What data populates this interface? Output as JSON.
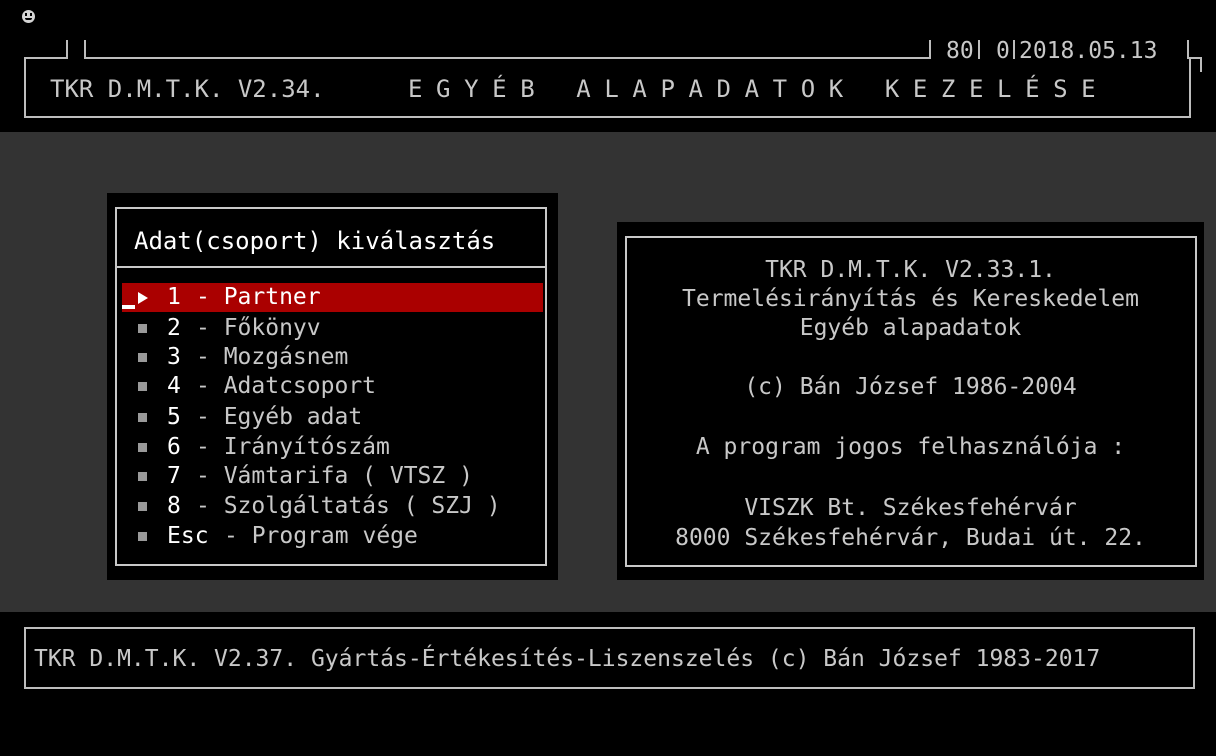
{
  "header": {
    "app_version": "TKR D.M.T.K. V2.34.",
    "screen_title": "EGYÉB ALAPADATOK KEZELÉSE",
    "stat_a": "80",
    "stat_b": "0",
    "date": "2018.05.13"
  },
  "menu": {
    "title": "Adat(csoport) kiválasztás",
    "selected_index": 0,
    "items": [
      {
        "key": "1",
        "label": "- Partner"
      },
      {
        "key": "2",
        "label": "- Főkönyv"
      },
      {
        "key": "3",
        "label": "- Mozgásnem"
      },
      {
        "key": "4",
        "label": "- Adatcsoport"
      },
      {
        "key": "5",
        "label": "- Egyéb adat"
      },
      {
        "key": "6",
        "label": "- Irányítószám"
      },
      {
        "key": "7",
        "label": "- Vámtarifa ( VTSZ )"
      },
      {
        "key": "8",
        "label": "- Szolgáltatás ( SZJ )"
      },
      {
        "key": "Esc",
        "label": "- Program vége"
      }
    ]
  },
  "info": {
    "version": "TKR D.M.T.K. V2.33.1.",
    "subtitle": "Termelésirányítás és Kereskedelem",
    "module": "Egyéb alapadatok",
    "copyright": "(c) Bán József 1986-2004",
    "licensee_label": "A program jogos felhasználója :",
    "licensee_name": "VISZK Bt. Székesfehérvár",
    "licensee_address": "8000 Székesfehérvár, Budai út. 22."
  },
  "footer": {
    "text": "TKR D.M.T.K. V2.37. Gyártás-Értékesítés-Liszenszelés (c) Bán József 1983-2017"
  },
  "colors": {
    "selection": "#aa0000",
    "panel_bg": "#000000",
    "desktop_bg": "#333333",
    "text": "#c8c8c8"
  },
  "icons": {
    "corner": "smiley-face-icon",
    "selected_marker": "arrow-right-icon",
    "item_marker": "square-bullet-icon"
  }
}
